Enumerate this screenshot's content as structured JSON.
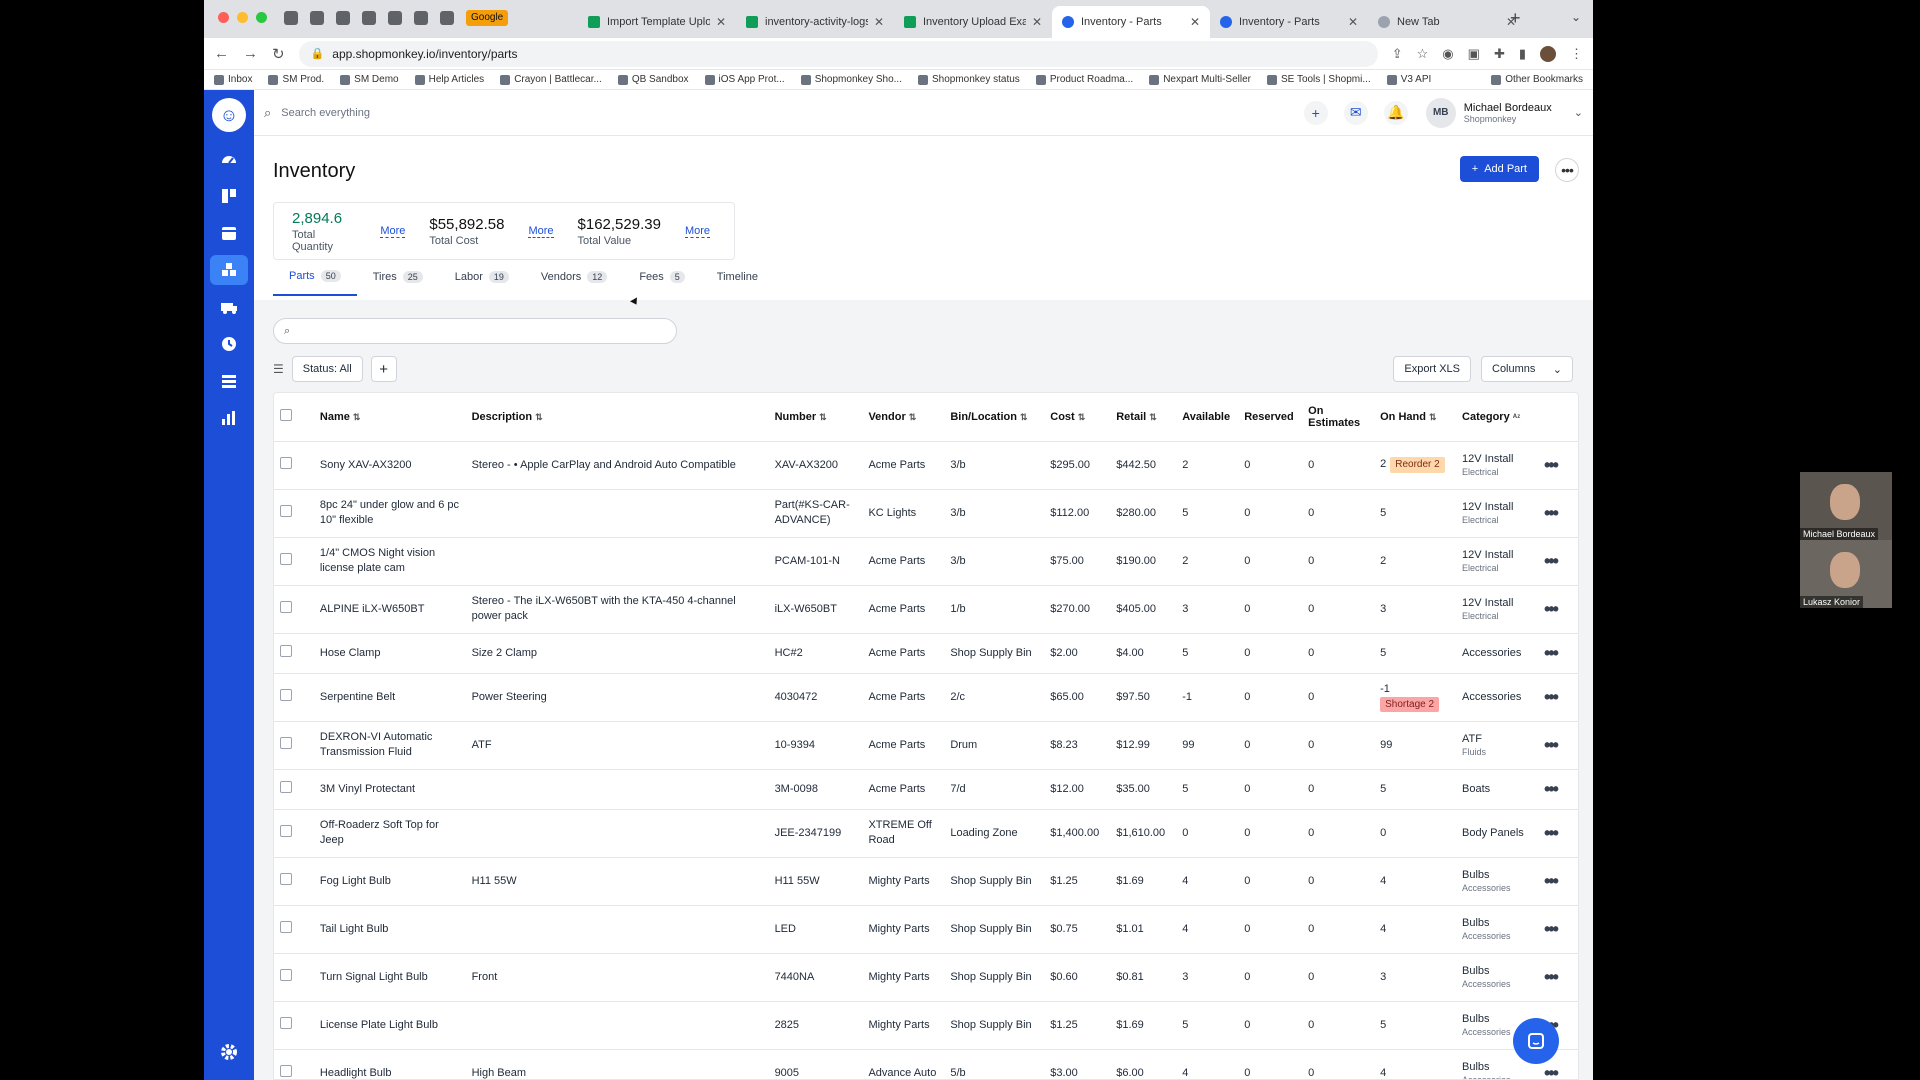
{
  "browser": {
    "pinned": [
      "Google"
    ],
    "tabs": [
      {
        "label": "Import Template Upload",
        "active": false
      },
      {
        "label": "inventory-activity-logs",
        "active": false
      },
      {
        "label": "Inventory Upload Exam",
        "active": false
      },
      {
        "label": "Inventory - Parts",
        "active": true
      },
      {
        "label": "Inventory - Parts",
        "active": false
      },
      {
        "label": "New Tab",
        "active": false
      }
    ],
    "url": "app.shopmonkey.io/inventory/parts",
    "bookmarks": [
      "Inbox",
      "SM Prod.",
      "SM Demo",
      "Help Articles",
      "Crayon | Battlecar...",
      "QB Sandbox",
      "iOS App Prot...",
      "Shopmonkey Sho...",
      "Shopmonkey status",
      "Product Roadma...",
      "Nexpart Multi-Seller",
      "SE Tools | Shopmi...",
      "V3 API"
    ],
    "other_bookmarks": "Other Bookmarks"
  },
  "topbar": {
    "search_placeholder": "Search everything",
    "user_initials": "MB",
    "user_name": "Michael Bordeaux",
    "user_company": "Shopmonkey"
  },
  "page": {
    "title": "Inventory",
    "add_button": "Add Part"
  },
  "stats": [
    {
      "value": "2,894.6",
      "label": "Total Quantity",
      "more": "More"
    },
    {
      "value": "$55,892.58",
      "label": "Total Cost",
      "more": "More"
    },
    {
      "value": "$162,529.39",
      "label": "Total Value",
      "more": "More"
    }
  ],
  "tabs": [
    {
      "label": "Parts",
      "count": "50"
    },
    {
      "label": "Tires",
      "count": "25"
    },
    {
      "label": "Labor",
      "count": "19"
    },
    {
      "label": "Vendors",
      "count": "12"
    },
    {
      "label": "Fees",
      "count": "5"
    },
    {
      "label": "Timeline",
      "count": ""
    }
  ],
  "filters": {
    "status_chip": "Status: All",
    "export": "Export XLS",
    "columns": "Columns"
  },
  "table": {
    "headers": [
      "Name",
      "Description",
      "Number",
      "Vendor",
      "Bin/Location",
      "Cost",
      "Retail",
      "Available",
      "Reserved",
      "On Estimates",
      "On Hand",
      "Category"
    ],
    "rows": [
      {
        "name": "Sony XAV-AX3200",
        "description": "Stereo - • Apple CarPlay and Android Auto Compatible",
        "number": "XAV-AX3200",
        "vendor": "Acme Parts",
        "bin": "3/b",
        "cost": "$295.00",
        "retail": "$442.50",
        "available": "2",
        "reserved": "0",
        "on_estimates": "0",
        "on_hand": "2",
        "badge": "Reorder 2",
        "category": "12V Install",
        "subcategory": "Electrical"
      },
      {
        "name": "8pc 24\" under glow and 6 pc 10\" flexible",
        "description": "",
        "number": "Part(#KS-CAR-ADVANCE)",
        "vendor": "KC Lights",
        "bin": "3/b",
        "cost": "$112.00",
        "retail": "$280.00",
        "available": "5",
        "reserved": "0",
        "on_estimates": "0",
        "on_hand": "5",
        "badge": "",
        "category": "12V Install",
        "subcategory": "Electrical"
      },
      {
        "name": "1/4\" CMOS Night vision license plate cam",
        "description": "",
        "number": "PCAM-101-N",
        "vendor": "Acme Parts",
        "bin": "3/b",
        "cost": "$75.00",
        "retail": "$190.00",
        "available": "2",
        "reserved": "0",
        "on_estimates": "0",
        "on_hand": "2",
        "badge": "",
        "category": "12V Install",
        "subcategory": "Electrical"
      },
      {
        "name": "ALPINE iLX-W650BT",
        "description": "Stereo - The iLX-W650BT with the KTA-450 4-channel power pack",
        "number": "iLX-W650BT",
        "vendor": "Acme Parts",
        "bin": "1/b",
        "cost": "$270.00",
        "retail": "$405.00",
        "available": "3",
        "reserved": "0",
        "on_estimates": "0",
        "on_hand": "3",
        "badge": "",
        "category": "12V Install",
        "subcategory": "Electrical"
      },
      {
        "name": "Hose Clamp",
        "description": "Size 2 Clamp",
        "number": "HC#2",
        "vendor": "Acme Parts",
        "bin": "Shop Supply Bin",
        "cost": "$2.00",
        "retail": "$4.00",
        "available": "5",
        "reserved": "0",
        "on_estimates": "0",
        "on_hand": "5",
        "badge": "",
        "category": "Accessories",
        "subcategory": ""
      },
      {
        "name": "Serpentine Belt",
        "description": "Power Steering",
        "number": "4030472",
        "vendor": "Acme Parts",
        "bin": "2/c",
        "cost": "$65.00",
        "retail": "$97.50",
        "available": "-1",
        "reserved": "0",
        "on_estimates": "0",
        "on_hand": "-1",
        "badge": "Shortage 2",
        "category": "Accessories",
        "subcategory": ""
      },
      {
        "name": "DEXRON-VI Automatic Transmission Fluid",
        "description": "ATF",
        "number": "10-9394",
        "vendor": "Acme Parts",
        "bin": "Drum",
        "cost": "$8.23",
        "retail": "$12.99",
        "available": "99",
        "reserved": "0",
        "on_estimates": "0",
        "on_hand": "99",
        "badge": "",
        "category": "ATF",
        "subcategory": "Fluids"
      },
      {
        "name": "3M Vinyl Protectant",
        "description": "",
        "number": "3M-0098",
        "vendor": "Acme Parts",
        "bin": "7/d",
        "cost": "$12.00",
        "retail": "$35.00",
        "available": "5",
        "reserved": "0",
        "on_estimates": "0",
        "on_hand": "5",
        "badge": "",
        "category": "Boats",
        "subcategory": ""
      },
      {
        "name": "Off-Roaderz Soft Top for Jeep",
        "description": "",
        "number": "JEE-2347199",
        "vendor": "XTREME Off Road",
        "bin": "Loading Zone",
        "cost": "$1,400.00",
        "retail": "$1,610.00",
        "available": "0",
        "reserved": "0",
        "on_estimates": "0",
        "on_hand": "0",
        "badge": "",
        "category": "Body Panels",
        "subcategory": ""
      },
      {
        "name": "Fog Light Bulb",
        "description": "H11 55W",
        "number": "H11 55W",
        "vendor": "Mighty Parts",
        "bin": "Shop Supply Bin",
        "cost": "$1.25",
        "retail": "$1.69",
        "available": "4",
        "reserved": "0",
        "on_estimates": "0",
        "on_hand": "4",
        "badge": "",
        "category": "Bulbs",
        "subcategory": "Accessories"
      },
      {
        "name": "Tail Light Bulb",
        "description": "",
        "number": "LED",
        "vendor": "Mighty Parts",
        "bin": "Shop Supply Bin",
        "cost": "$0.75",
        "retail": "$1.01",
        "available": "4",
        "reserved": "0",
        "on_estimates": "0",
        "on_hand": "4",
        "badge": "",
        "category": "Bulbs",
        "subcategory": "Accessories"
      },
      {
        "name": "Turn Signal Light Bulb",
        "description": "Front",
        "number": "7440NA",
        "vendor": "Mighty Parts",
        "bin": "Shop Supply Bin",
        "cost": "$0.60",
        "retail": "$0.81",
        "available": "3",
        "reserved": "0",
        "on_estimates": "0",
        "on_hand": "3",
        "badge": "",
        "category": "Bulbs",
        "subcategory": "Accessories"
      },
      {
        "name": "License Plate Light Bulb",
        "description": "",
        "number": "2825",
        "vendor": "Mighty Parts",
        "bin": "Shop Supply Bin",
        "cost": "$1.25",
        "retail": "$1.69",
        "available": "5",
        "reserved": "0",
        "on_estimates": "0",
        "on_hand": "5",
        "badge": "",
        "category": "Bulbs",
        "subcategory": "Accessories"
      },
      {
        "name": "Headlight Bulb",
        "description": "High Beam",
        "number": "9005",
        "vendor": "Advance Auto",
        "bin": "5/b",
        "cost": "$3.00",
        "retail": "$6.00",
        "available": "4",
        "reserved": "0",
        "on_estimates": "0",
        "on_hand": "4",
        "badge": "",
        "category": "Bulbs",
        "subcategory": "Accessories"
      }
    ]
  },
  "video": [
    {
      "name": "Michael Bordeaux"
    },
    {
      "name": "Lukasz Konior"
    }
  ],
  "colors": {
    "brand": "#1d4ed8",
    "reorder": "#fed7aa",
    "shortage": "#fca5a5",
    "stat_green": "#047857"
  }
}
